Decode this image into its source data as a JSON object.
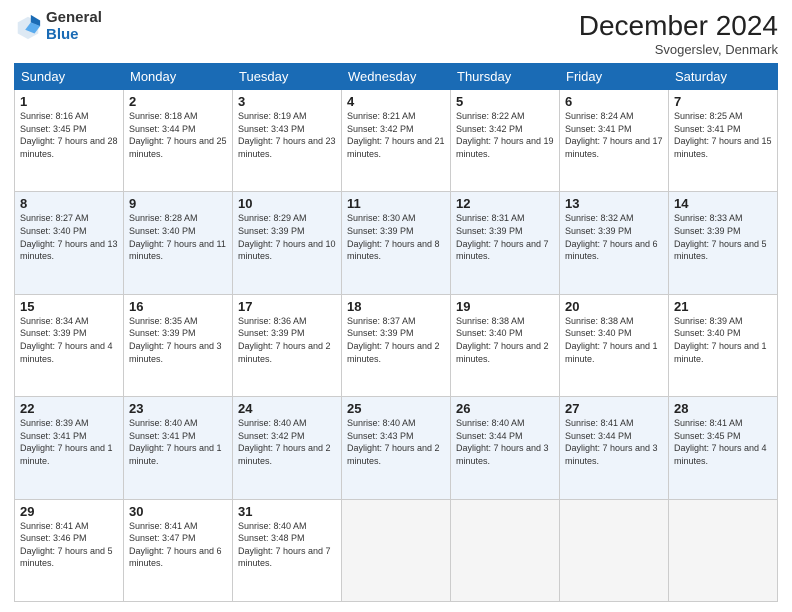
{
  "header": {
    "logo_general": "General",
    "logo_blue": "Blue",
    "title": "December 2024",
    "location": "Svogerslev, Denmark"
  },
  "days_of_week": [
    "Sunday",
    "Monday",
    "Tuesday",
    "Wednesday",
    "Thursday",
    "Friday",
    "Saturday"
  ],
  "weeks": [
    [
      {
        "day": "1",
        "sunrise": "8:16 AM",
        "sunset": "3:45 PM",
        "daylight": "7 hours and 28 minutes."
      },
      {
        "day": "2",
        "sunrise": "8:18 AM",
        "sunset": "3:44 PM",
        "daylight": "7 hours and 25 minutes."
      },
      {
        "day": "3",
        "sunrise": "8:19 AM",
        "sunset": "3:43 PM",
        "daylight": "7 hours and 23 minutes."
      },
      {
        "day": "4",
        "sunrise": "8:21 AM",
        "sunset": "3:42 PM",
        "daylight": "7 hours and 21 minutes."
      },
      {
        "day": "5",
        "sunrise": "8:22 AM",
        "sunset": "3:42 PM",
        "daylight": "7 hours and 19 minutes."
      },
      {
        "day": "6",
        "sunrise": "8:24 AM",
        "sunset": "3:41 PM",
        "daylight": "7 hours and 17 minutes."
      },
      {
        "day": "7",
        "sunrise": "8:25 AM",
        "sunset": "3:41 PM",
        "daylight": "7 hours and 15 minutes."
      }
    ],
    [
      {
        "day": "8",
        "sunrise": "8:27 AM",
        "sunset": "3:40 PM",
        "daylight": "7 hours and 13 minutes."
      },
      {
        "day": "9",
        "sunrise": "8:28 AM",
        "sunset": "3:40 PM",
        "daylight": "7 hours and 11 minutes."
      },
      {
        "day": "10",
        "sunrise": "8:29 AM",
        "sunset": "3:39 PM",
        "daylight": "7 hours and 10 minutes."
      },
      {
        "day": "11",
        "sunrise": "8:30 AM",
        "sunset": "3:39 PM",
        "daylight": "7 hours and 8 minutes."
      },
      {
        "day": "12",
        "sunrise": "8:31 AM",
        "sunset": "3:39 PM",
        "daylight": "7 hours and 7 minutes."
      },
      {
        "day": "13",
        "sunrise": "8:32 AM",
        "sunset": "3:39 PM",
        "daylight": "7 hours and 6 minutes."
      },
      {
        "day": "14",
        "sunrise": "8:33 AM",
        "sunset": "3:39 PM",
        "daylight": "7 hours and 5 minutes."
      }
    ],
    [
      {
        "day": "15",
        "sunrise": "8:34 AM",
        "sunset": "3:39 PM",
        "daylight": "7 hours and 4 minutes."
      },
      {
        "day": "16",
        "sunrise": "8:35 AM",
        "sunset": "3:39 PM",
        "daylight": "7 hours and 3 minutes."
      },
      {
        "day": "17",
        "sunrise": "8:36 AM",
        "sunset": "3:39 PM",
        "daylight": "7 hours and 2 minutes."
      },
      {
        "day": "18",
        "sunrise": "8:37 AM",
        "sunset": "3:39 PM",
        "daylight": "7 hours and 2 minutes."
      },
      {
        "day": "19",
        "sunrise": "8:38 AM",
        "sunset": "3:40 PM",
        "daylight": "7 hours and 2 minutes."
      },
      {
        "day": "20",
        "sunrise": "8:38 AM",
        "sunset": "3:40 PM",
        "daylight": "7 hours and 1 minute."
      },
      {
        "day": "21",
        "sunrise": "8:39 AM",
        "sunset": "3:40 PM",
        "daylight": "7 hours and 1 minute."
      }
    ],
    [
      {
        "day": "22",
        "sunrise": "8:39 AM",
        "sunset": "3:41 PM",
        "daylight": "7 hours and 1 minute."
      },
      {
        "day": "23",
        "sunrise": "8:40 AM",
        "sunset": "3:41 PM",
        "daylight": "7 hours and 1 minute."
      },
      {
        "day": "24",
        "sunrise": "8:40 AM",
        "sunset": "3:42 PM",
        "daylight": "7 hours and 2 minutes."
      },
      {
        "day": "25",
        "sunrise": "8:40 AM",
        "sunset": "3:43 PM",
        "daylight": "7 hours and 2 minutes."
      },
      {
        "day": "26",
        "sunrise": "8:40 AM",
        "sunset": "3:44 PM",
        "daylight": "7 hours and 3 minutes."
      },
      {
        "day": "27",
        "sunrise": "8:41 AM",
        "sunset": "3:44 PM",
        "daylight": "7 hours and 3 minutes."
      },
      {
        "day": "28",
        "sunrise": "8:41 AM",
        "sunset": "3:45 PM",
        "daylight": "7 hours and 4 minutes."
      }
    ],
    [
      {
        "day": "29",
        "sunrise": "8:41 AM",
        "sunset": "3:46 PM",
        "daylight": "7 hours and 5 minutes."
      },
      {
        "day": "30",
        "sunrise": "8:41 AM",
        "sunset": "3:47 PM",
        "daylight": "7 hours and 6 minutes."
      },
      {
        "day": "31",
        "sunrise": "8:40 AM",
        "sunset": "3:48 PM",
        "daylight": "7 hours and 7 minutes."
      },
      null,
      null,
      null,
      null
    ]
  ]
}
